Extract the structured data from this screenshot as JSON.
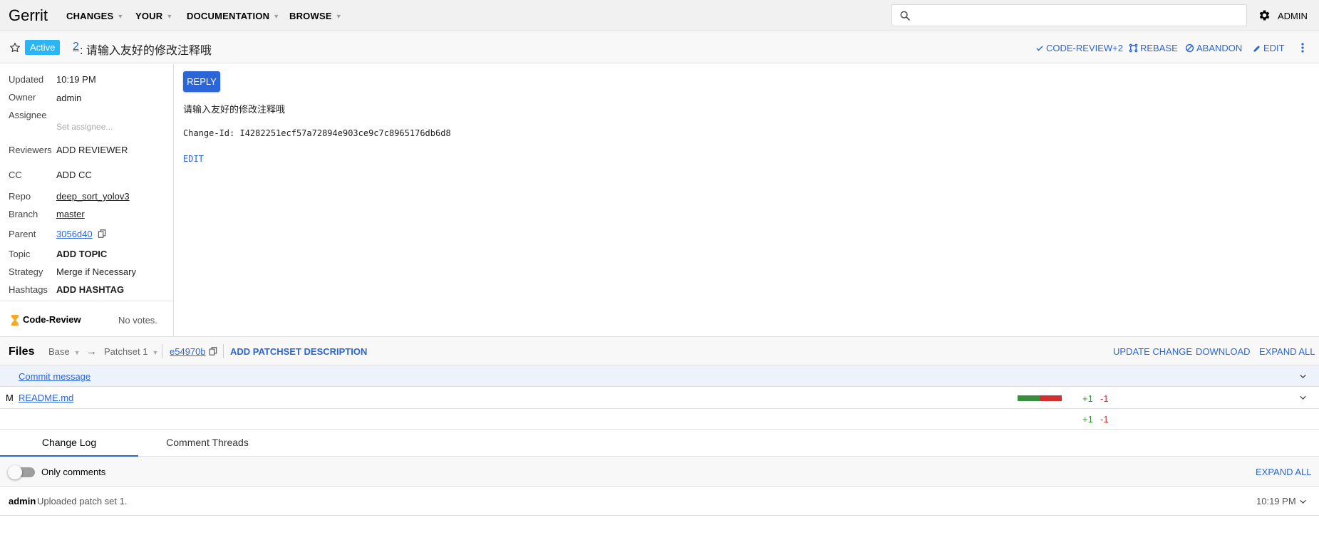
{
  "app": {
    "title": "Gerrit",
    "nav": [
      {
        "label": "CHANGES"
      },
      {
        "label": "YOUR"
      },
      {
        "label": "DOCUMENTATION"
      },
      {
        "label": "BROWSE"
      }
    ],
    "user": "ADMIN"
  },
  "change": {
    "status": "Active",
    "number": "2",
    "title": ": 请输入友好的修改注释哦",
    "actions": [
      "CODE-REVIEW+2",
      "REBASE",
      "ABANDON",
      "EDIT"
    ]
  },
  "meta": {
    "updated_label": "Updated",
    "updated": "10:19 PM",
    "owner_label": "Owner",
    "owner": "admin",
    "assignee_label": "Assignee",
    "assignee_placeholder": "Set assignee...",
    "reviewers_label": "Reviewers",
    "add_reviewer": "ADD REVIEWER",
    "cc_label": "CC",
    "add_cc": "ADD CC",
    "repo_label": "Repo",
    "repo": "deep_sort_yolov3",
    "branch_label": "Branch",
    "branch": "master",
    "parent_label": "Parent",
    "parent": "3056d40",
    "topic_label": "Topic",
    "add_topic": "ADD TOPIC",
    "strategy_label": "Strategy",
    "strategy": "Merge if Necessary",
    "hashtags_label": "Hashtags",
    "add_hashtag": "ADD HASHTAG",
    "label_name": "Code-Review",
    "label_votes": "No votes."
  },
  "message": {
    "reply": "REPLY",
    "subject": "请输入友好的修改注释哦",
    "change_id": "Change-Id: I4282251ecf57a72894e903ce9c7c8965176db6d8",
    "edit": "EDIT"
  },
  "files": {
    "title": "Files",
    "base": "Base",
    "patchset": "Patchset 1",
    "commit": "e54970b",
    "add_description": "ADD PATCHSET DESCRIPTION",
    "actions": [
      "UPDATE CHANGE",
      "DOWNLOAD",
      "EXPAND ALL"
    ],
    "commit_message_link": "Commit message",
    "rows": [
      {
        "status": "M",
        "path": "README.md",
        "added": "+1",
        "removed": "-1",
        "added_fraction": 0.5
      }
    ],
    "total_added": "+1",
    "total_removed": "-1"
  },
  "tabs": [
    "Change Log",
    "Comment Threads"
  ],
  "changelog": {
    "toggle_label": "Only comments",
    "toggle_on": false,
    "expand_all": "EXPAND ALL",
    "entries": [
      {
        "author": "admin",
        "message": "Uploaded patch set 1.",
        "time": "10:19 PM"
      }
    ]
  },
  "colors": {
    "accent": "#2a66d9",
    "status_active": "#29b6f6",
    "added": "#388e3c",
    "removed": "#d32f2f",
    "label_pending": "#f9a825"
  }
}
